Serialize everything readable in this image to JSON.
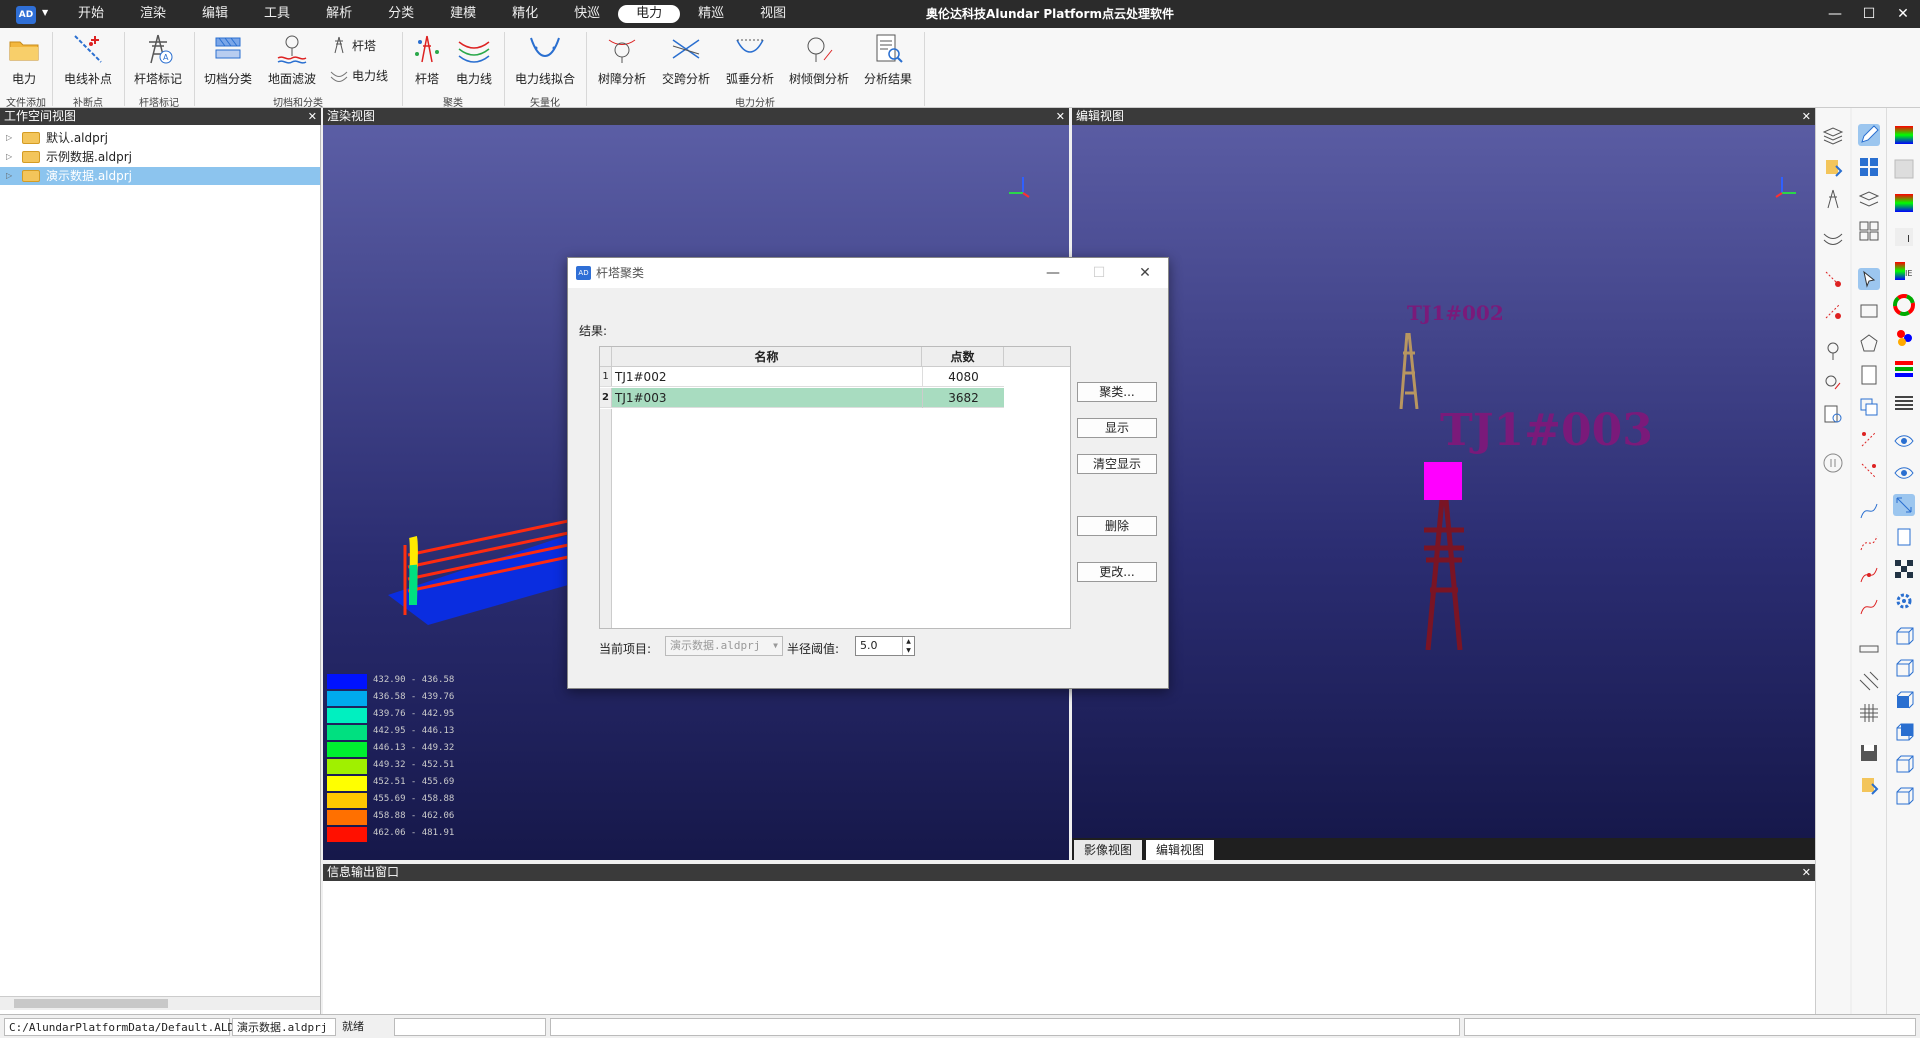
{
  "app": {
    "logo": "AD",
    "title": "奥伦达科技Alundar Platform点云处理软件",
    "window_controls": {
      "minimize": "—",
      "maximize": "☐",
      "close": "✕"
    }
  },
  "menu": [
    "开始",
    "渲染",
    "编辑",
    "工具",
    "解析",
    "分类",
    "建模",
    "精化",
    "快巡",
    "电力",
    "精巡",
    "视图"
  ],
  "menu_active": "电力",
  "ribbon": {
    "buttons": [
      "电力",
      "电线补点",
      "杆塔标记",
      "切档分类",
      "地面滤波",
      "杆塔",
      "电力线",
      "电力线拟合",
      "树障分析",
      "交跨分析",
      "弧垂分析",
      "树倾倒分析",
      "分析结果"
    ],
    "small_buttons": [
      "杆塔",
      "电力线"
    ],
    "groups": [
      "文件添加",
      "补断点",
      "杆塔标记",
      "切档和分类",
      "聚类",
      "矢量化",
      "电力分析"
    ]
  },
  "workspace": {
    "title": "工作空间视图",
    "close": "✕",
    "items": [
      "默认.aldprj",
      "示例数据.aldprj",
      "演示数据.aldprj"
    ],
    "selected_index": 2
  },
  "render_view": {
    "title": "渲染视图",
    "close": "✕"
  },
  "edit_view": {
    "title": "编辑视图",
    "close": "✕",
    "labels": [
      "TJ1#002",
      "TJ1#003"
    ]
  },
  "bottom_tabs": [
    "影像视图",
    "编辑视图"
  ],
  "bottom_tab_active": "编辑视图",
  "info_window": {
    "title": "信息输出窗口",
    "close": "✕"
  },
  "legend": [
    {
      "range": "432.90 - 436.58",
      "color": "#0012ff"
    },
    {
      "range": "436.58 - 439.76",
      "color": "#00aaee"
    },
    {
      "range": "439.76 - 442.95",
      "color": "#00f0c0"
    },
    {
      "range": "442.95 - 446.13",
      "color": "#00e080"
    },
    {
      "range": "446.13 - 449.32",
      "color": "#00f030"
    },
    {
      "range": "449.32 - 452.51",
      "color": "#a0f000"
    },
    {
      "range": "452.51 - 455.69",
      "color": "#ffff00"
    },
    {
      "range": "455.69 - 458.88",
      "color": "#ffc800"
    },
    {
      "range": "458.88 - 462.06",
      "color": "#ff7000"
    },
    {
      "range": "462.06 - 481.91",
      "color": "#ff1000"
    }
  ],
  "dialog": {
    "icon": "AD",
    "title": "杆塔聚类",
    "controls": {
      "minimize": "—",
      "maximize": "☐",
      "close": "✕"
    },
    "result_label": "结果:",
    "columns": [
      "名称",
      "点数"
    ],
    "rows": [
      {
        "index": "1",
        "name": "TJ1#002",
        "count": "4080"
      },
      {
        "index": "2",
        "name": "TJ1#003",
        "count": "3682"
      }
    ],
    "selected_row": 1,
    "buttons": [
      "聚类...",
      "显示",
      "清空显示",
      "删除",
      "更改..."
    ],
    "current_item_label": "当前项目:",
    "current_item_value": "演示数据.aldprj",
    "radius_label": "半径阈值:",
    "radius_value": "5.0"
  },
  "status": {
    "path": "C:/AlundarPlatformData/Default.ALDWS",
    "project": "演示数据.aldprj",
    "state": "就绪"
  }
}
